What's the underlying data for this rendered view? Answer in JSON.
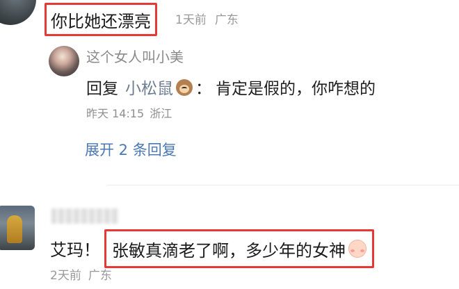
{
  "comment_top": {
    "text": "你比她还漂亮",
    "time": "1天前",
    "location": "广东"
  },
  "reply": {
    "username": "这个女人叫小美",
    "label": "回复",
    "reply_to": "小松鼠",
    "to_emoji": "monkey-emoji",
    "colon": "：",
    "content": "肯定是假的，你咋想的",
    "time": "昨天 14:15",
    "location": "浙江"
  },
  "expand_replies": "展开 2 条回复",
  "comment_bottom": {
    "prefix": "艾玛！",
    "highlighted_text": "张敏真滴老了啊，多少年的女神",
    "emoji": "blush-emoji",
    "time": "2天前",
    "location": "广东"
  },
  "colors": {
    "highlight_border": "#e53935",
    "link": "#4a78b5",
    "username": "#8a8a8a",
    "meta": "#999999"
  }
}
